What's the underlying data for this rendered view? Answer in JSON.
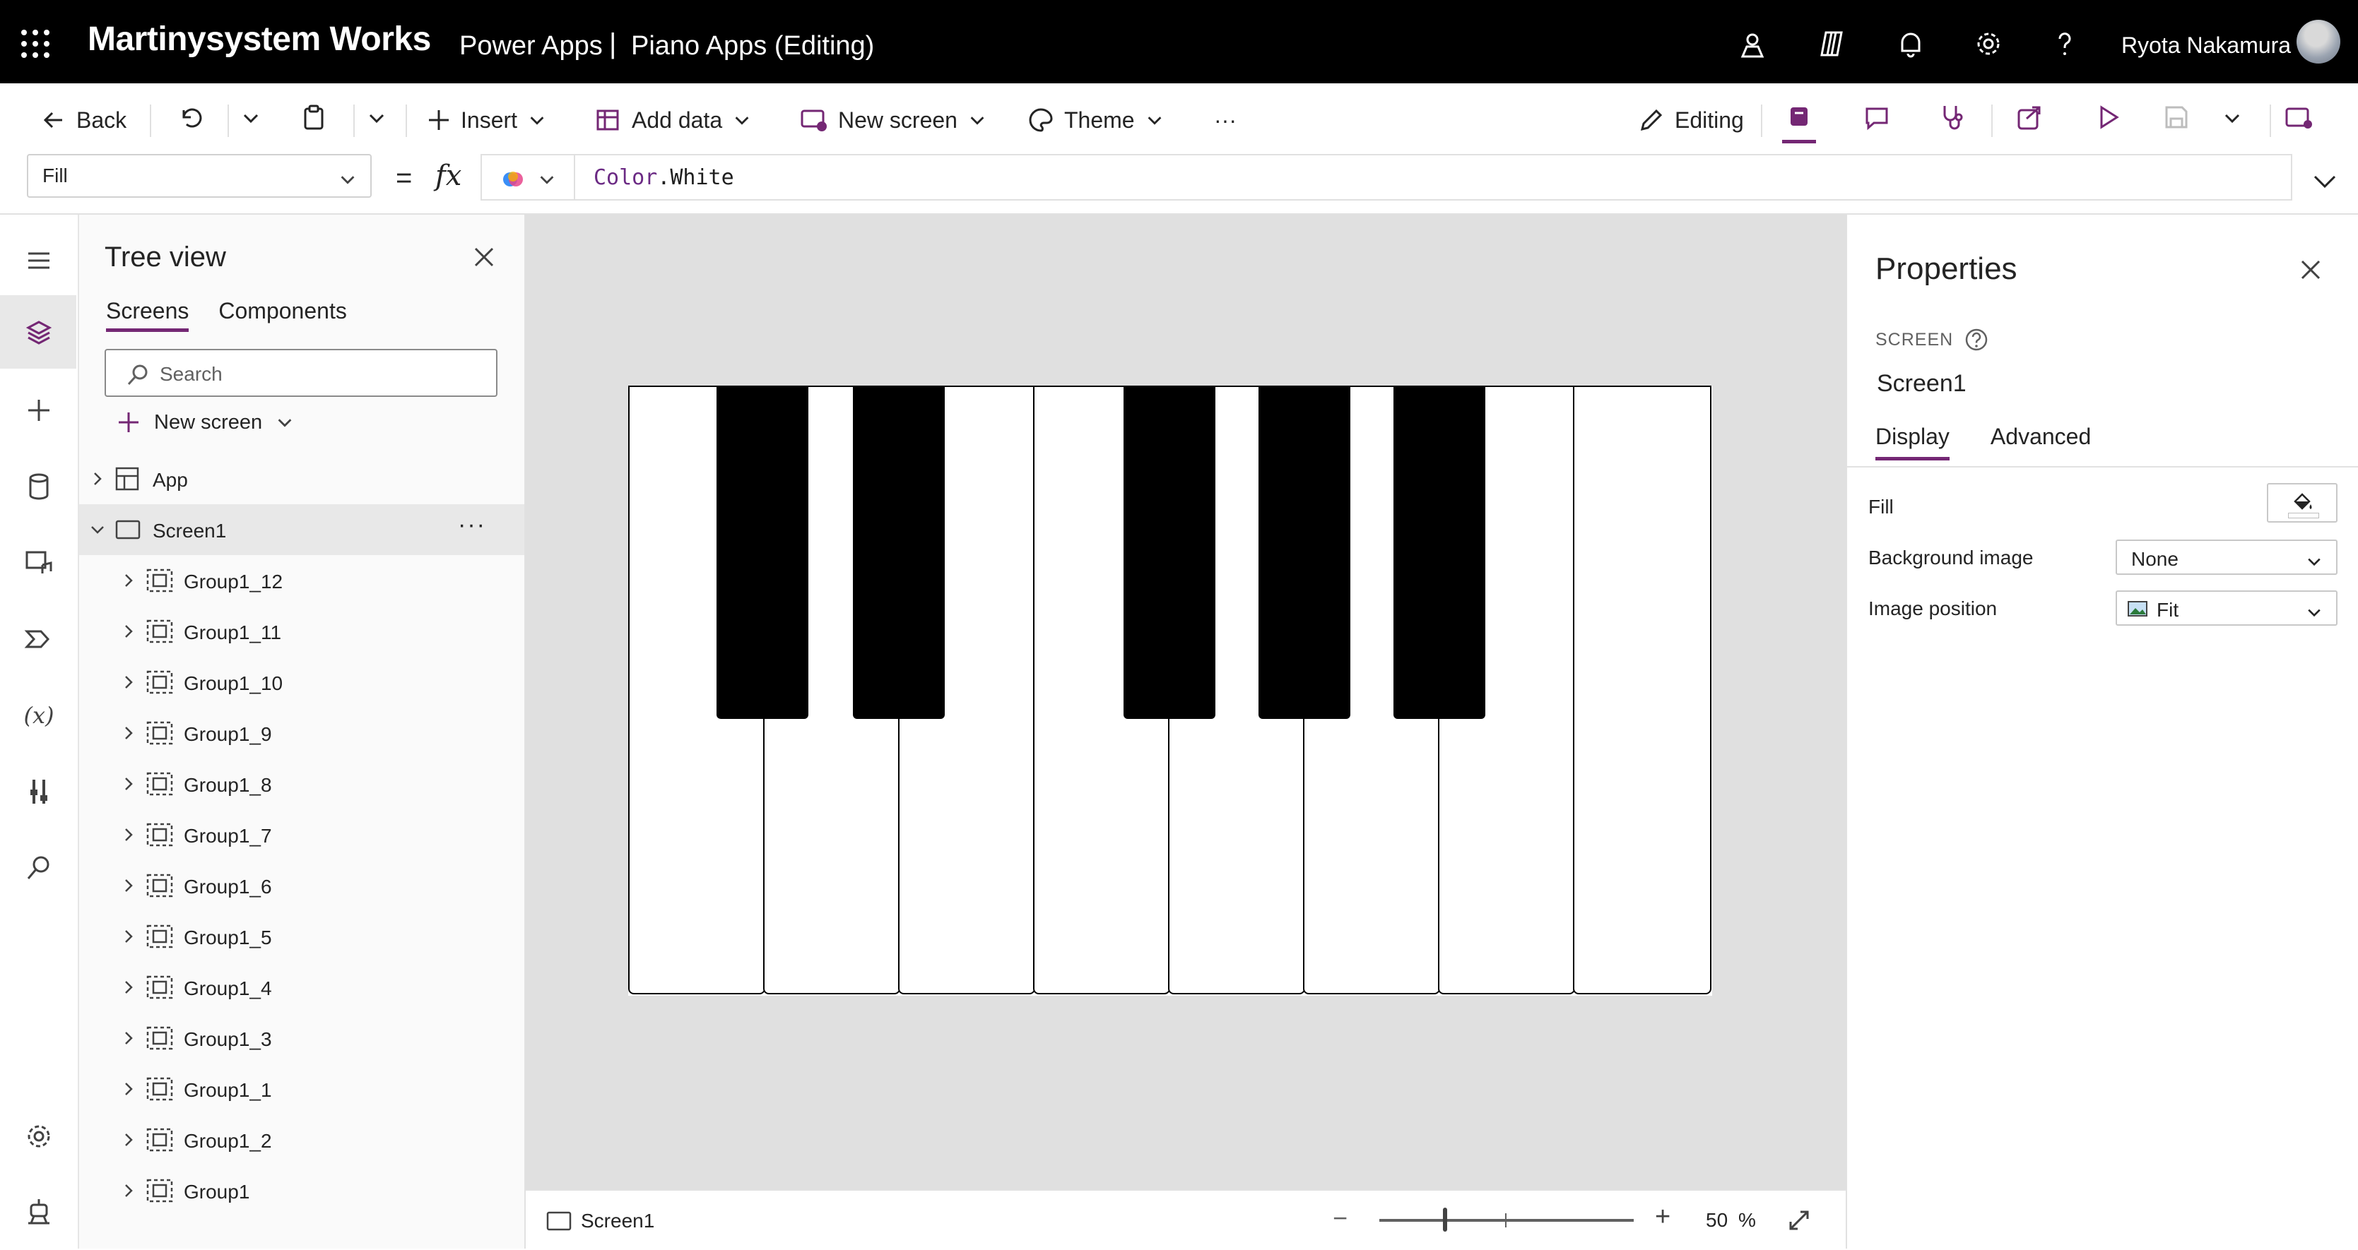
{
  "header": {
    "brand": "Martinysystem Works",
    "product": "Power Apps",
    "separator": "|",
    "app_title": "Piano Apps (Editing)",
    "user_name": "Ryota Nakamura",
    "icons": [
      "waffle-icon",
      "environment-icon",
      "copilot-icon",
      "notifications-icon",
      "settings-icon",
      "help-icon"
    ]
  },
  "toolbar": {
    "back": "Back",
    "insert": "Insert",
    "add_data": "Add data",
    "new_screen": "New screen",
    "theme": "Theme",
    "more": "···",
    "editing": "Editing"
  },
  "formula": {
    "property": "Fill",
    "equals": "=",
    "fx": "fx",
    "object": "Color",
    "dot": ".",
    "member": "White"
  },
  "tree": {
    "title": "Tree view",
    "tabs": [
      "Screens",
      "Components"
    ],
    "search_placeholder": "Search",
    "new_screen": "New screen",
    "app_label": "App",
    "screen_label": "Screen1",
    "more": "···",
    "groups": [
      "Group1_12",
      "Group1_11",
      "Group1_10",
      "Group1_9",
      "Group1_8",
      "Group1_7",
      "Group1_6",
      "Group1_5",
      "Group1_4",
      "Group1_3",
      "Group1_1",
      "Group1_2",
      "Group1"
    ]
  },
  "status": {
    "screen": "Screen1",
    "zoom_value": "50",
    "zoom_unit": "%",
    "zoom_minus": "−",
    "zoom_plus": "+"
  },
  "properties": {
    "title": "Properties",
    "kind": "SCREEN",
    "screen_name": "Screen1",
    "tabs": [
      "Display",
      "Advanced"
    ],
    "fill_label": "Fill",
    "fill_value": "#FFFFFF",
    "bg_image_label": "Background image",
    "bg_image_value": "None",
    "image_position_label": "Image position",
    "image_position_value": "Fit"
  },
  "colors": {
    "accent": "#742774",
    "canvas_bg": "#E0E0E0",
    "key_white": "#FFFFFF",
    "key_black": "#000000"
  }
}
